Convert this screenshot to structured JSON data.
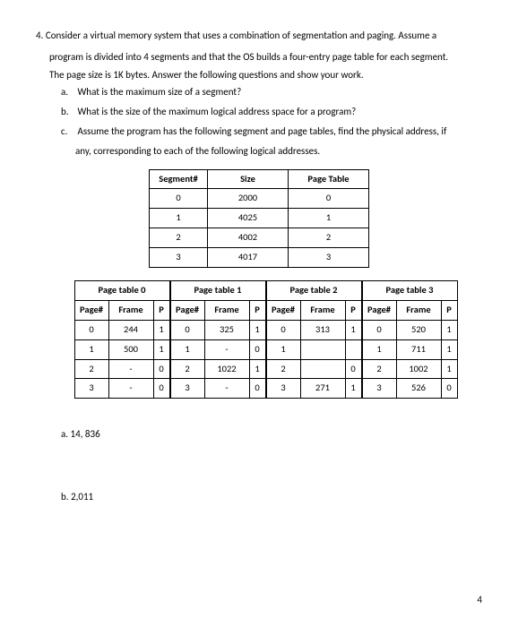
{
  "question": {
    "number": "4.",
    "intro1": "Consider a virtual memory system that uses a combination of segmentation and paging. Assume a",
    "intro2": "program is divided into 4 segments and that the OS builds a four-entry page table for each segment.",
    "intro3": "The page size is 1K bytes. Answer the following questions and show your work.",
    "a": {
      "letter": "a.",
      "text": "What is the maximum size of a segment?"
    },
    "b": {
      "letter": "b.",
      "text": "What is the size of the maximum logical address space for a program?"
    },
    "c": {
      "letter": "c.",
      "text": "Assume the program has the following segment and page tables, find the physical address, if",
      "text2": "any, corresponding to each of the following logical addresses."
    }
  },
  "seg_table": {
    "headers": [
      "Segment#",
      "Size",
      "Page Table"
    ],
    "rows": [
      [
        "0",
        "2000",
        "0"
      ],
      [
        "1",
        "4025",
        "1"
      ],
      [
        "2",
        "4002",
        "2"
      ],
      [
        "3",
        "4017",
        "3"
      ]
    ]
  },
  "page_tables": [
    {
      "title": "Page table 0",
      "headers": [
        "Page#",
        "Frame",
        "P"
      ],
      "rows": [
        [
          "0",
          "244",
          "1"
        ],
        [
          "1",
          "500",
          "1"
        ],
        [
          "2",
          "-",
          "0"
        ],
        [
          "3",
          "-",
          "0"
        ]
      ]
    },
    {
      "title": "Page table 1",
      "headers": [
        "Page#",
        "Frame",
        "P"
      ],
      "rows": [
        [
          "0",
          "325",
          "1"
        ],
        [
          "1",
          "-",
          "0"
        ],
        [
          "2",
          "1022",
          "1"
        ],
        [
          "3",
          "-",
          "0"
        ]
      ]
    },
    {
      "title": "Page table 2",
      "headers": [
        "Page#",
        "Frame",
        "P"
      ],
      "rows": [
        [
          "0",
          "313",
          "1"
        ],
        [
          "1",
          "",
          ""
        ],
        [
          "2",
          "",
          "0"
        ],
        [
          "3",
          "271",
          "1"
        ]
      ]
    },
    {
      "title": "Page table 3",
      "headers": [
        "Page#",
        "Frame",
        "P"
      ],
      "rows": [
        [
          "0",
          "520",
          "1"
        ],
        [
          "1",
          "711",
          "1"
        ],
        [
          "2",
          "1002",
          "1"
        ],
        [
          "3",
          "526",
          "0"
        ]
      ]
    }
  ],
  "answers": {
    "a": {
      "letter": "a.",
      "text": "14, 836"
    },
    "b": {
      "letter": "b.",
      "text": "2,011"
    }
  },
  "page_number": "4"
}
